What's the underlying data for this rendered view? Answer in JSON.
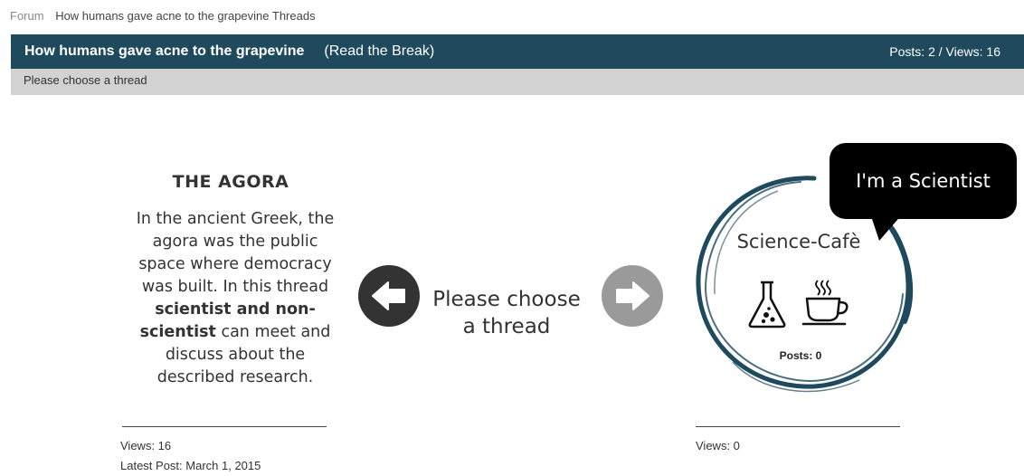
{
  "breadcrumb": {
    "root": "Forum",
    "current": "How humans gave acne to the grapevine Threads"
  },
  "header": {
    "title": "How humans gave acne to the grapevine",
    "subtitle": "(Read the Break)",
    "stats": "Posts: 2 / Views: 16",
    "subheading": "Please choose a thread"
  },
  "agora": {
    "title": "THE AGORA",
    "line1": "In the ancient Greek, the",
    "line2": "agora was the public",
    "line3": "space where democracy",
    "line4": "was built. In this thread",
    "bold1": "scientist and non-",
    "bold2": "scientist",
    "line6": "can meet and",
    "line7": "discuss about the",
    "line8": "described research.",
    "views": "Views: 16",
    "latest_post": "Latest Post: March 1, 2015"
  },
  "chooser": {
    "line1": "Please choose",
    "line2": "a thread"
  },
  "cafe": {
    "title": "Science-Cafè",
    "posts": "Posts: 0",
    "bubble": "I'm a Scientist",
    "views": "Views: 0"
  },
  "colors": {
    "header_bg": "#1f4a5e",
    "subbar_bg": "#d2d2d2",
    "circle_stroke": "#1f4a5e"
  },
  "icons": [
    "arrow-left-icon",
    "arrow-right-icon",
    "flask-icon",
    "coffee-cup-icon"
  ]
}
